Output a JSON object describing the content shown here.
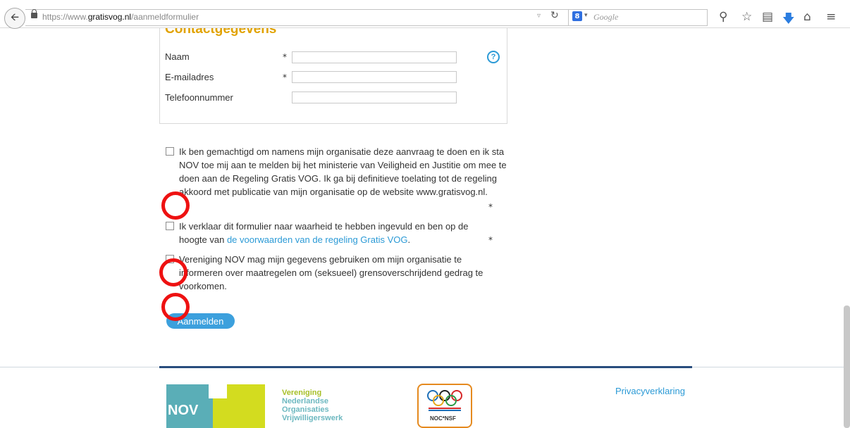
{
  "browser": {
    "url_prefix": "https://www.",
    "url_domain": "gratisvog.nl",
    "url_path": "/aanmeldformulier",
    "search_placeholder": "Google",
    "search_engine_letter": "8"
  },
  "form": {
    "heading": "Contactgegevens",
    "fields": [
      {
        "label": "Naam",
        "required_mark": "*",
        "value": ""
      },
      {
        "label": "E-mailadres",
        "required_mark": "*",
        "value": ""
      },
      {
        "label": "Telefoonnummer",
        "required_mark": "",
        "value": ""
      }
    ],
    "help_label": "?"
  },
  "checkboxes": {
    "authorize": {
      "text": "Ik ben gemachtigd om namens mijn organisatie deze aanvraag te doen en ik sta NOV toe mij aan te melden bij het ministerie van Veiligheid en Justitie om mee te doen aan de Regeling Gratis VOG. Ik ga bij definitieve toelating tot de regeling akkoord met publicatie van mijn organisatie op de website www.gratisvog.nl.",
      "required_mark": "*",
      "checked": false
    },
    "truth": {
      "text_before": "Ik verklaar dit formulier naar waarheid te hebben ingevuld en ben op de hoogte van ",
      "link": "de voorwaarden van de regeling Gratis VOG",
      "text_after": ".",
      "required_mark": "*",
      "checked": false
    },
    "newsletter": {
      "text": "Vereniging NOV mag mijn gegevens gebruiken om mijn organisatie te informeren over maatregelen om (seksueel) grensoverschrijdend gedrag te voorkomen.",
      "checked": false
    }
  },
  "submit_label": "Aanmelden",
  "footer": {
    "nov_logo_text": "NOV",
    "nov_name_lines": [
      "Vereniging",
      "Nederlandse",
      "Organisaties",
      "Vrijwilligerswerk"
    ],
    "noc_text": "NOC*NSF",
    "privacy_link": "Privacyverklaring"
  },
  "colors": {
    "accent_blue": "#2b9ad6",
    "heading_gold": "#e1a200",
    "annotation_red": "#ee1111"
  }
}
